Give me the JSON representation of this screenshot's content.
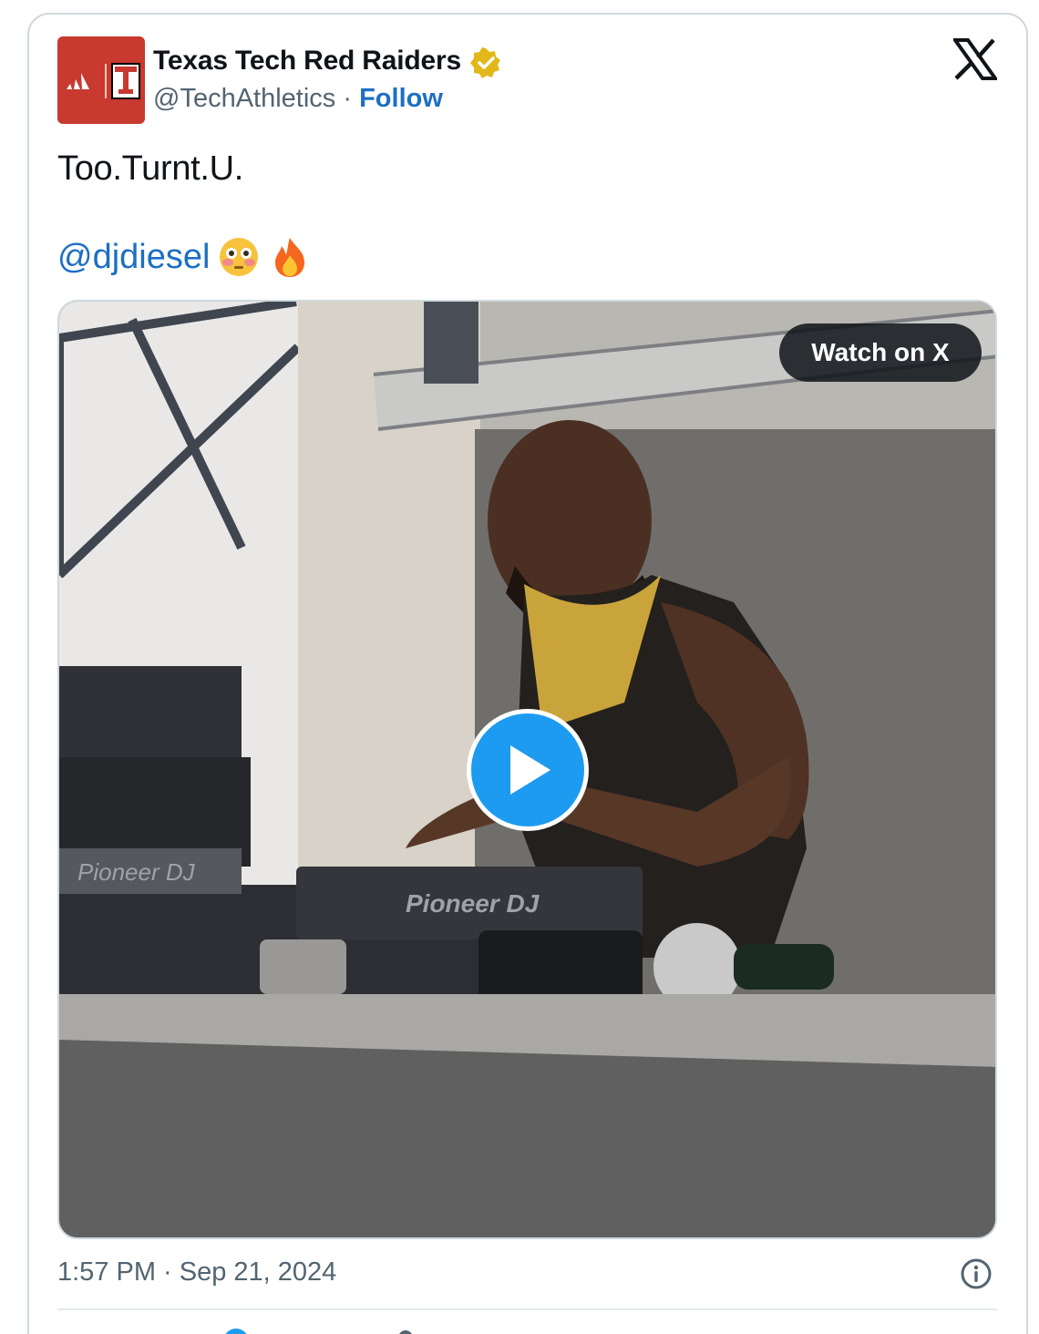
{
  "account": {
    "display_name": "Texas Tech Red Raiders",
    "handle": "@TechAthletics",
    "separator": "·",
    "follow_label": "Follow",
    "verified": true,
    "verified_color": "#e2b719",
    "avatar_color": "#c8392f"
  },
  "post": {
    "text": "Too.Turnt.U.",
    "mention": "@djdiesel",
    "emojis": [
      "flushed-face",
      "fire"
    ]
  },
  "media": {
    "watch_label": "Watch on X",
    "overlay_text_left": "Pioneer DJ",
    "overlay_text_right": "Pioneer DJ"
  },
  "meta": {
    "timestamp": "1:57 PM · Sep 21, 2024"
  },
  "colors": {
    "link": "#1d6fc3",
    "muted": "#536471",
    "play_button": "#1d9bf0",
    "border": "#cfd9de"
  },
  "icons": [
    "verified-badge-icon",
    "x-logo-icon",
    "play-icon",
    "info-icon"
  ]
}
